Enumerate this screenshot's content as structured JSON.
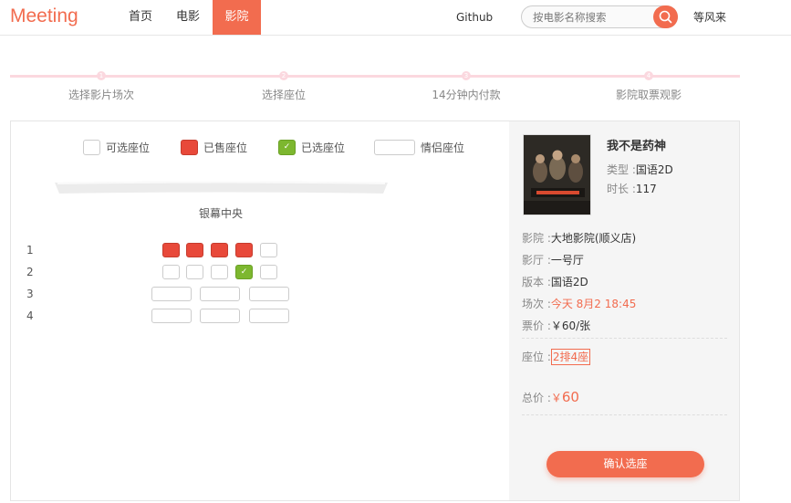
{
  "header": {
    "logo": "Meeting",
    "nav": {
      "home": "首页",
      "movies": "电影",
      "cinemas": "影院"
    },
    "github": "Github",
    "search_placeholder": "按电影名称搜索",
    "username": "等风来"
  },
  "steps": [
    {
      "num": "1",
      "label": "选择影片场次"
    },
    {
      "num": "2",
      "label": "选择座位"
    },
    {
      "num": "3",
      "label": "14分钟内付款"
    },
    {
      "num": "4",
      "label": "影院取票观影"
    }
  ],
  "legend": {
    "available": "可选座位",
    "sold": "已售座位",
    "selected": "已选座位",
    "couple": "情侣座位"
  },
  "screen_label": "银幕中央",
  "rows": [
    "1",
    "2",
    "3",
    "4"
  ],
  "seat_check": "✓",
  "movie": {
    "title": "我不是药神",
    "type_key": "类型 :",
    "type": "国语2D",
    "duration_key": "时长 :",
    "duration": "117"
  },
  "order": {
    "cinema_key": "影院 :",
    "cinema": "大地影院(顺义店)",
    "hall_key": "影厅 :",
    "hall": "一号厅",
    "version_key": "版本 :",
    "version": "国语2D",
    "showtime_key": "场次 :",
    "showtime": "今天 8月2 18:45",
    "price_key": "票价 :",
    "price": "￥60/张",
    "seat_key": "座位 :",
    "seat": "2排4座",
    "total_key": "总价 :",
    "total_currency": "￥",
    "total": "60"
  },
  "confirm_button": "确认选座",
  "colors": {
    "accent": "#f26c4f",
    "sold": "#e8493a",
    "selected": "#7db72f"
  }
}
